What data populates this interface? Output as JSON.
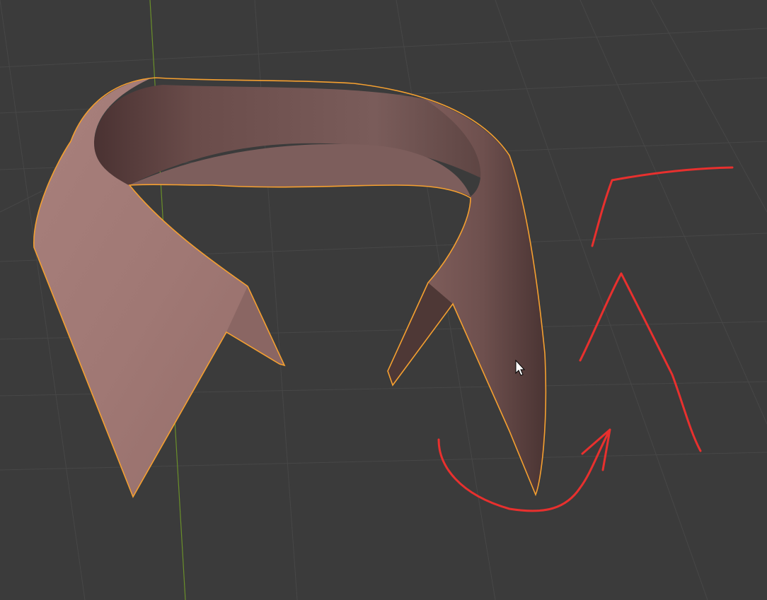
{
  "viewport": {
    "background_color": "#3b3b3b",
    "grid_color": "#4a4a4a",
    "y_axis_color": "#6a8f2a",
    "selection_outline_color": "#f5a030",
    "mesh_color": "#a27a76",
    "annotation_color": "#e8302e",
    "cursor_icon": "arrow-cursor-icon"
  }
}
